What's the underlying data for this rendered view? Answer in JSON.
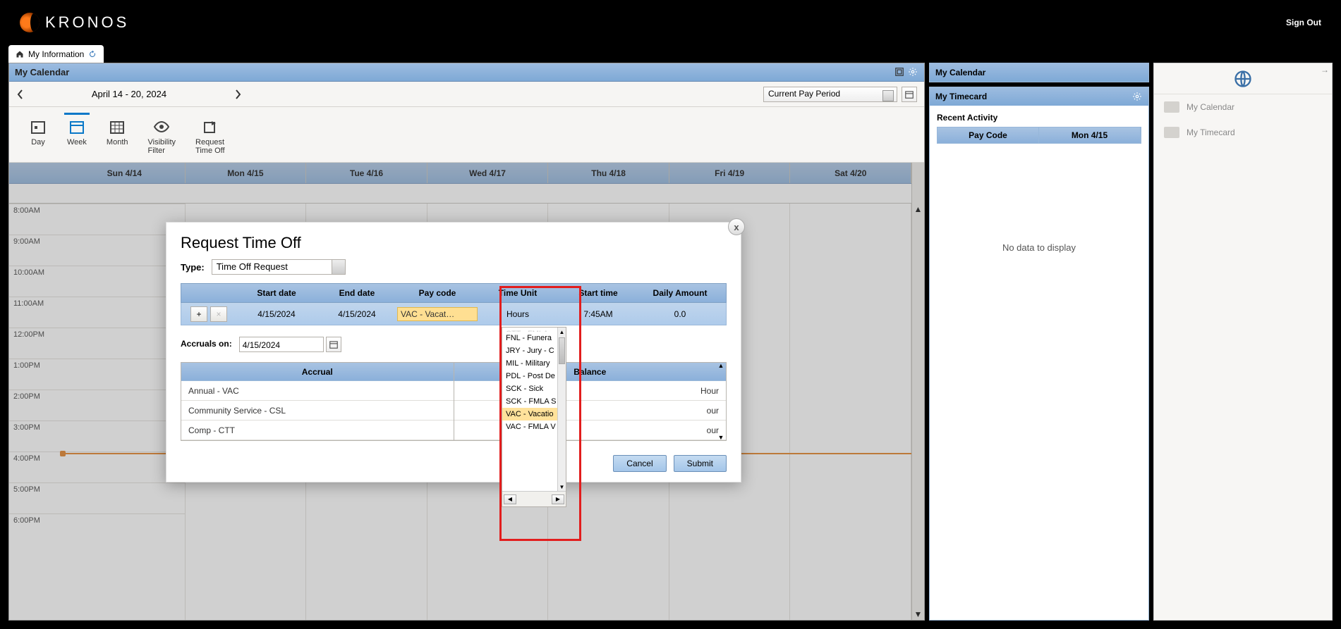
{
  "app": {
    "brand": "KRONOS",
    "signout": "Sign Out",
    "tab": "My Information"
  },
  "calendar": {
    "title": "My Calendar",
    "range_label": "April 14 - 20, 2024",
    "period_selected": "Current Pay Period",
    "view_buttons": {
      "day": "Day",
      "week": "Week",
      "month": "Month",
      "visibility": "Visibility\nFilter",
      "request": "Request\nTime Off"
    },
    "days": [
      "Sun 4/14",
      "Mon 4/15",
      "Tue 4/16",
      "Wed 4/17",
      "Thu 4/18",
      "Fri 4/19",
      "Sat 4/20"
    ],
    "time_labels": [
      "8:00AM",
      "9:00AM",
      "10:00AM",
      "11:00AM",
      "12:00PM",
      "1:00PM",
      "2:00PM",
      "3:00PM",
      "4:00PM",
      "5:00PM",
      "6:00PM"
    ]
  },
  "modal": {
    "title": "Request Time Off",
    "type_label": "Type:",
    "type_value": "Time Off Request",
    "headers": {
      "start": "Start date",
      "end": "End date",
      "pay": "Pay code",
      "time_unit": "Time Unit",
      "start_time": "Start time",
      "daily": "Daily Amount"
    },
    "row": {
      "start": "4/15/2024",
      "end": "4/15/2024",
      "pay": "VAC - Vacat…",
      "time_unit": "Hours",
      "start_time": "7:45AM",
      "daily": "0.0"
    },
    "accruals_label": "Accruals on:",
    "accruals_date": "4/15/2024",
    "accrual_header_left": "Accrual",
    "accrual_header_right": "Balance",
    "accruals": [
      {
        "name": "Annual - VAC",
        "bal": "Hour"
      },
      {
        "name": "Community Service - CSL",
        "bal": "our"
      },
      {
        "name": "Comp - CTT",
        "bal": "our"
      }
    ],
    "paycode_options": [
      {
        "label": "CTT - FMLA",
        "sel": false,
        "hidden": true
      },
      {
        "label": "FNL - Funera",
        "sel": false
      },
      {
        "label": "JRY - Jury - C",
        "sel": false
      },
      {
        "label": "MIL - Military",
        "sel": false
      },
      {
        "label": "PDL - Post De",
        "sel": false
      },
      {
        "label": "SCK - Sick",
        "sel": false
      },
      {
        "label": "SCK - FMLA S",
        "sel": false
      },
      {
        "label": "VAC - Vacatio",
        "sel": true
      },
      {
        "label": "VAC - FMLA V",
        "sel": false
      }
    ],
    "buttons": {
      "cancel": "Cancel",
      "submit": "Submit"
    }
  },
  "side": {
    "calendar_title": "My Calendar",
    "timecard_title": "My Timecard",
    "recent_title": "Recent Activity",
    "col1": "Pay Code",
    "col2": "Mon 4/15",
    "nodata": "No data to display"
  },
  "quick": {
    "calendar": "My Calendar",
    "timecard": "My Timecard"
  }
}
